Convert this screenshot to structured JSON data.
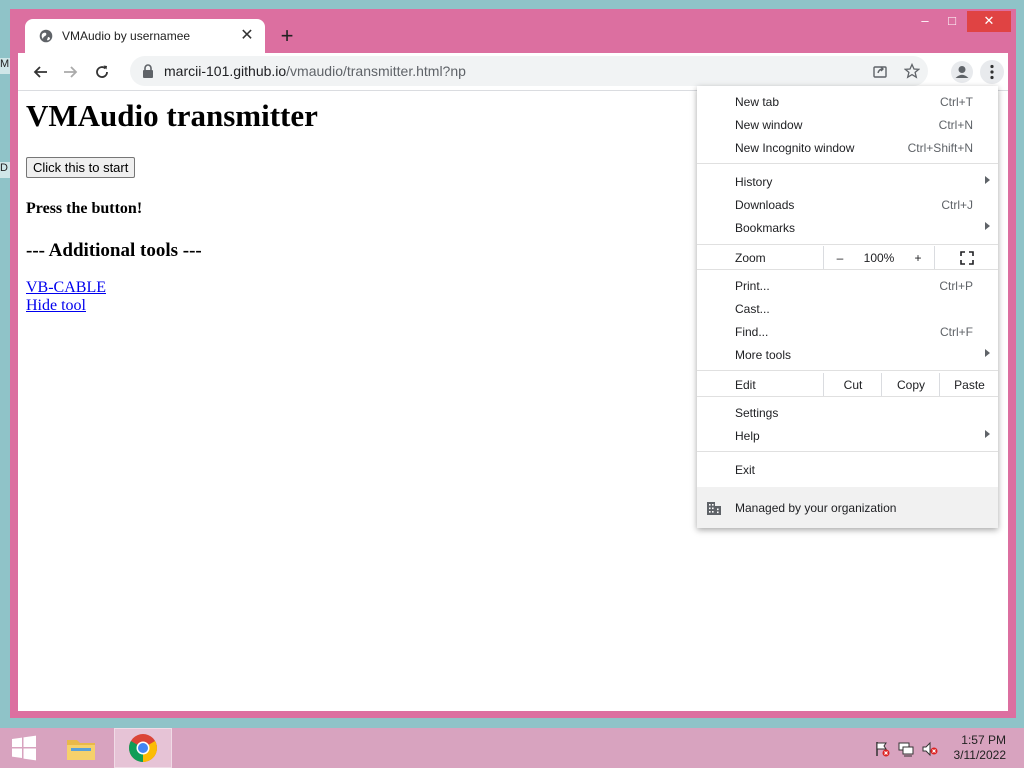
{
  "desktop": {
    "glyph_top": "M",
    "glyph_mid": "D"
  },
  "tab": {
    "title": "VMAudio by usernamee",
    "close": "✕"
  },
  "new_tab_symbol": "+",
  "window_controls": {
    "minimize": "–",
    "maximize": "□",
    "close": "✕"
  },
  "address": {
    "host": "marcii-101.github.io",
    "path": "/vmaudio/transmitter.html?np"
  },
  "page": {
    "heading": "VMAudio transmitter",
    "start_button": "Click this to start",
    "status": "Press the button!",
    "tools_heading": "--- Additional tools ---",
    "link_vbcable": "VB-CABLE",
    "link_hide": "Hide tool"
  },
  "menu": {
    "new_tab": {
      "label": "New tab",
      "shortcut": "Ctrl+T"
    },
    "new_window": {
      "label": "New window",
      "shortcut": "Ctrl+N"
    },
    "new_incognito": {
      "label": "New Incognito window",
      "shortcut": "Ctrl+Shift+N"
    },
    "history": {
      "label": "History"
    },
    "downloads": {
      "label": "Downloads",
      "shortcut": "Ctrl+J"
    },
    "bookmarks": {
      "label": "Bookmarks"
    },
    "zoom": {
      "label": "Zoom",
      "minus": "–",
      "value": "100%",
      "plus": "+"
    },
    "print": {
      "label": "Print...",
      "shortcut": "Ctrl+P"
    },
    "cast": {
      "label": "Cast..."
    },
    "find": {
      "label": "Find...",
      "shortcut": "Ctrl+F"
    },
    "more_tools": {
      "label": "More tools"
    },
    "edit": {
      "label": "Edit",
      "cut": "Cut",
      "copy": "Copy",
      "paste": "Paste"
    },
    "settings": {
      "label": "Settings"
    },
    "help": {
      "label": "Help"
    },
    "exit": {
      "label": "Exit"
    },
    "managed": {
      "label": "Managed by your organization"
    }
  },
  "clock": {
    "time": "1:57 PM",
    "date": "3/11/2022"
  },
  "colors": {
    "frame": "#dc6fa0",
    "taskbar": "#d8a3bf",
    "link": "#0000ee",
    "close_button": "#e04343"
  }
}
